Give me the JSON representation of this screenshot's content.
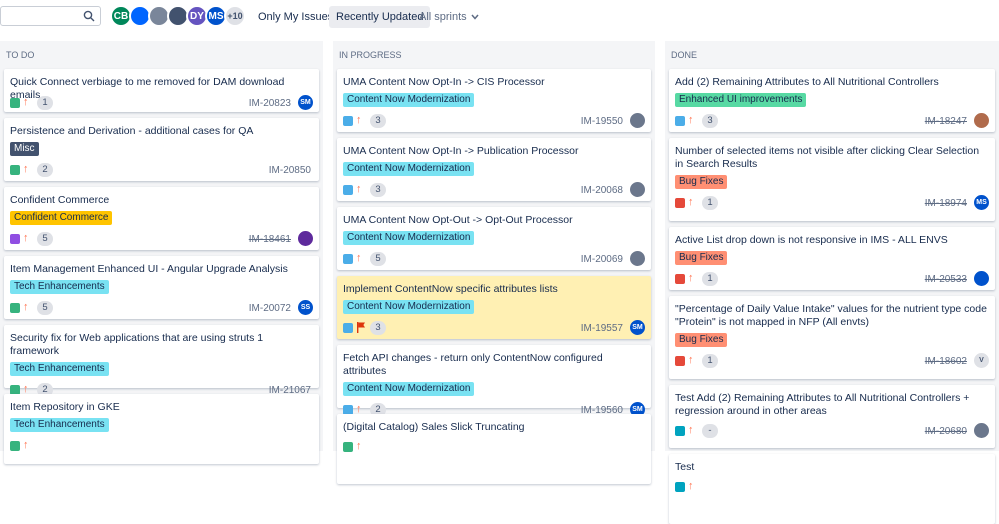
{
  "toolbar": {
    "avatars": [
      {
        "initials": "CB",
        "color": "#00875a"
      },
      {
        "initials": "",
        "color": "#0065ff"
      },
      {
        "initials": "",
        "color": "#7a869a"
      },
      {
        "initials": "",
        "color": "#42526e"
      },
      {
        "initials": "DY",
        "color": "#6554c0"
      },
      {
        "initials": "MS",
        "color": "#0052cc"
      },
      {
        "initials": "+10",
        "color": "#dfe1e6"
      }
    ],
    "only_my_issues": "Only My Issues",
    "recently_updated": "Recently Updated",
    "all_sprints": "All sprints"
  },
  "columns": [
    {
      "title": "TO DO",
      "cards": [
        {
          "summary": "Quick Connect verbiage to me removed for DAM download emails",
          "epic": "",
          "type": "story",
          "prio": "major",
          "points": "1",
          "key": "IM-20823",
          "done": false,
          "assignee": "SM",
          "assignee_color": "#0052cc"
        },
        {
          "summary": "Persistence and Derivation - additional cases for QA",
          "epic": "Misc",
          "epic_bg": "#42526e",
          "epic_fg": "#ffffff",
          "type": "story",
          "prio": "major",
          "points": "2",
          "key": "IM-20850",
          "done": false,
          "assignee": "",
          "assignee_color": ""
        },
        {
          "summary": "Confident Commerce",
          "epic": "Confident Commerce",
          "epic_bg": "#ffc400",
          "epic_fg": "#172b4d",
          "type": "epic",
          "prio": "major",
          "points": "5",
          "key": "IM-18461",
          "done": true,
          "assignee": "",
          "assignee_color": "#5e2a9c"
        },
        {
          "summary": "Item Management Enhanced UI - Angular Upgrade Analysis",
          "epic": "Tech Enhancements",
          "epic_bg": "#79e2f2",
          "epic_fg": "#172b4d",
          "type": "story",
          "prio": "major",
          "points": "5",
          "key": "IM-20072",
          "done": false,
          "assignee": "SS",
          "assignee_color": "#0052cc"
        },
        {
          "summary": "Security fix for Web applications that are using struts 1 framework",
          "epic": "Tech Enhancements",
          "epic_bg": "#79e2f2",
          "epic_fg": "#172b4d",
          "type": "story",
          "prio": "major",
          "points": "2",
          "key": "IM-21067",
          "done": false,
          "assignee": "",
          "assignee_color": ""
        },
        {
          "summary": "Item Repository in GKE",
          "epic": "Tech Enhancements",
          "epic_bg": "#79e2f2",
          "epic_fg": "#172b4d",
          "type": "story",
          "prio": "major",
          "points": "",
          "key": "",
          "done": false,
          "assignee": "",
          "assignee_color": ""
        }
      ]
    },
    {
      "title": "IN PROGRESS",
      "cards": [
        {
          "summary": "UMA Content Now Opt-In -> CIS Processor",
          "epic": "Content Now Modernization",
          "epic_bg": "#79e2f2",
          "epic_fg": "#172b4d",
          "type": "subtask",
          "prio": "major",
          "points": "3",
          "key": "IM-19550",
          "done": false,
          "assignee": "",
          "assignee_color": "#6b778c"
        },
        {
          "summary": "UMA Content Now Opt-In -> Publication Processor",
          "epic": "Content Now Modernization",
          "epic_bg": "#79e2f2",
          "epic_fg": "#172b4d",
          "type": "subtask",
          "prio": "major",
          "points": "3",
          "key": "IM-20068",
          "done": false,
          "assignee": "",
          "assignee_color": "#6b778c"
        },
        {
          "summary": "UMA Content Now Opt-Out -> Opt-Out Processor",
          "epic": "Content Now Modernization",
          "epic_bg": "#79e2f2",
          "epic_fg": "#172b4d",
          "type": "subtask",
          "prio": "major",
          "points": "5",
          "key": "IM-20069",
          "done": false,
          "assignee": "",
          "assignee_color": "#6b778c"
        },
        {
          "summary": "Implement ContentNow specific attributes lists",
          "epic": "Content Now Modernization",
          "epic_bg": "#79e2f2",
          "epic_fg": "#172b4d",
          "type": "subtask",
          "prio": "flag",
          "points": "3",
          "key": "IM-19557",
          "done": false,
          "assignee": "SM",
          "assignee_color": "#0052cc",
          "flagged": true
        },
        {
          "summary": "Fetch API changes - return only ContentNow configured attributes",
          "epic": "Content Now Modernization",
          "epic_bg": "#79e2f2",
          "epic_fg": "#172b4d",
          "type": "subtask",
          "prio": "major",
          "points": "2",
          "key": "IM-19560",
          "done": false,
          "assignee": "SM",
          "assignee_color": "#0052cc"
        },
        {
          "summary": "(Digital Catalog) Sales Slick Truncating",
          "epic": "",
          "type": "story",
          "prio": "major",
          "points": "",
          "key": "",
          "done": false,
          "assignee": "",
          "assignee_color": ""
        }
      ]
    },
    {
      "title": "DONE",
      "cards": [
        {
          "summary": "Add (2) Remaining Attributes to All Nutritional Controllers",
          "epic": "Enhanced UI improvements",
          "epic_bg": "#57d9a3",
          "epic_fg": "#172b4d",
          "type": "subtask",
          "prio": "major",
          "points": "3",
          "key": "IM-18247",
          "done": true,
          "assignee": "",
          "assignee_color": "#b06b4c"
        },
        {
          "summary": "Number of selected items not visible after clicking Clear Selection in Search Results",
          "epic": "Bug Fixes",
          "epic_bg": "#ff8f73",
          "epic_fg": "#172b4d",
          "type": "bug",
          "prio": "major",
          "points": "1",
          "key": "IM-18974",
          "done": true,
          "assignee": "MS",
          "assignee_color": "#0052cc"
        },
        {
          "summary": "Active List drop down is not responsive in IMS - ALL ENVS",
          "epic": "Bug Fixes",
          "epic_bg": "#ff8f73",
          "epic_fg": "#172b4d",
          "type": "bug",
          "prio": "major",
          "points": "1",
          "key": "IM-20533",
          "done": true,
          "assignee": "",
          "assignee_color": "#0052cc"
        },
        {
          "summary": "\"Percentage of Daily Value Intake\" values for the nutrient type code \"Protein\" is not mapped in NFP (All envts)",
          "epic": "Bug Fixes",
          "epic_bg": "#ff8f73",
          "epic_fg": "#172b4d",
          "type": "bug",
          "prio": "major",
          "points": "1",
          "key": "IM-18602",
          "done": true,
          "assignee": "V",
          "assignee_color": "#dfe1e6"
        },
        {
          "summary": "Test Add (2) Remaining Attributes to All Nutritional Controllers + regression around in other areas",
          "epic": "",
          "type": "test",
          "prio": "major",
          "points": "-",
          "key": "IM-20680",
          "done": true,
          "assignee": "",
          "assignee_color": "#6b778c"
        },
        {
          "summary": "Test",
          "epic": "",
          "type": "test",
          "prio": "major",
          "points": "",
          "key": "",
          "done": false,
          "assignee": "",
          "assignee_color": ""
        }
      ]
    }
  ],
  "colors": {
    "story": "#36b37e",
    "subtask": "#4bade8",
    "epic": "#904ee2",
    "bug": "#e5493a",
    "test": "#00a3bf"
  }
}
